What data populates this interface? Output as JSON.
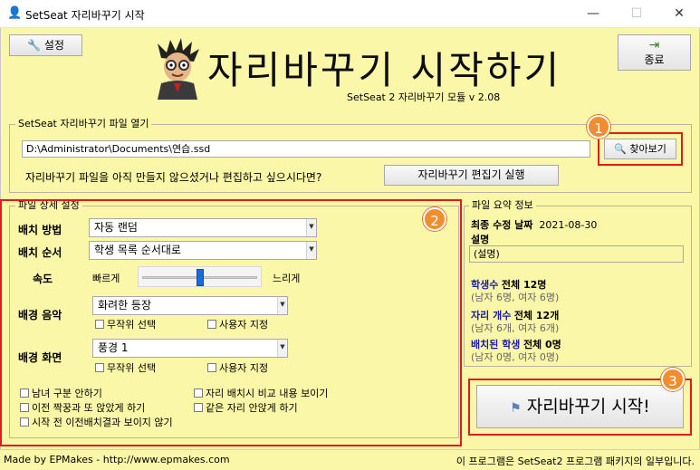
{
  "window": {
    "title": "SetSeat 자리바꾸기 시작",
    "minimize_glyph": "—",
    "maximize_glyph": "☐",
    "close_glyph": "✕"
  },
  "toolbar": {
    "settings_label": "설정",
    "exit_label": "종료"
  },
  "hero": {
    "title": "자리바꾸기 시작하기",
    "subtitle": "SetSeat 2 자리바꾸기 모듈 v 2.08"
  },
  "file_open": {
    "legend": "SetSeat 자리바꾸기 파일 열기",
    "path": "D:\\Administrator\\Documents\\연습.ssd",
    "browse_label": "찾아보기",
    "prompt": "자리바꾸기 파일을 아직 만들지 않으셨거나 편집하고 싶으시다면?",
    "editor_label": "자리바꾸기 편집기 실행"
  },
  "detail": {
    "legend": "파일 상세 설정",
    "method_label": "배치 방법",
    "method_value": "자동 랜덤",
    "order_label": "배치 순서",
    "order_value": "학생 목록 순서대로",
    "speed_label": "속도",
    "speed_fast": "빠르게",
    "speed_slow": "느리게",
    "speed_level": 0.5,
    "music_label": "배경 음악",
    "music_value": "화려한 등장",
    "music_random": "무작위 선택",
    "music_custom": "사용자 지정",
    "screen_label": "배경 화면",
    "screen_value": "풍경 1",
    "screen_random": "무작위 선택",
    "screen_custom": "사용자 지정",
    "opt_no_gender": "남녀 구분 안하기",
    "opt_compare": "자리 배치시 비교 내용 보이기",
    "opt_no_prev_partner": "이전 짝꿍과 또 앉았게 하기",
    "opt_no_same_seat": "같은 자리 안앉게 하기",
    "opt_hide_prev": "시작 전 이전배치결과 보이지 않기"
  },
  "summary": {
    "legend": "파일 요약 정보",
    "modified_label": "최종 수정 날짜",
    "modified_value": "2021-08-30",
    "desc_label": "설명",
    "desc_value": "(설명)",
    "students_title": "학생수",
    "students_total": "전체 12명",
    "students_detail": "(남자 6명, 여자 6명)",
    "seats_title": "자리 개수",
    "seats_total": "전체 12개",
    "seats_detail": "(남자 6개, 여자 6개)",
    "placed_title": "배치된 학생",
    "placed_total": "전체 0명",
    "placed_detail": "(남자 0명, 여자 0명)"
  },
  "start_label": "자리바꾸기 시작!",
  "badges": [
    "1",
    "2",
    "3"
  ],
  "footer": {
    "left": "Made by EPMakes - http://www.epmakes.com",
    "right": "이 프로그램은 SetSeat2 프로그램 패키지의 일부입니다."
  },
  "colors": {
    "background": "#fbf7a8",
    "highlight": "#e11b1b",
    "badge": "#f28d2f",
    "info_blue": "#1a1aa6"
  }
}
